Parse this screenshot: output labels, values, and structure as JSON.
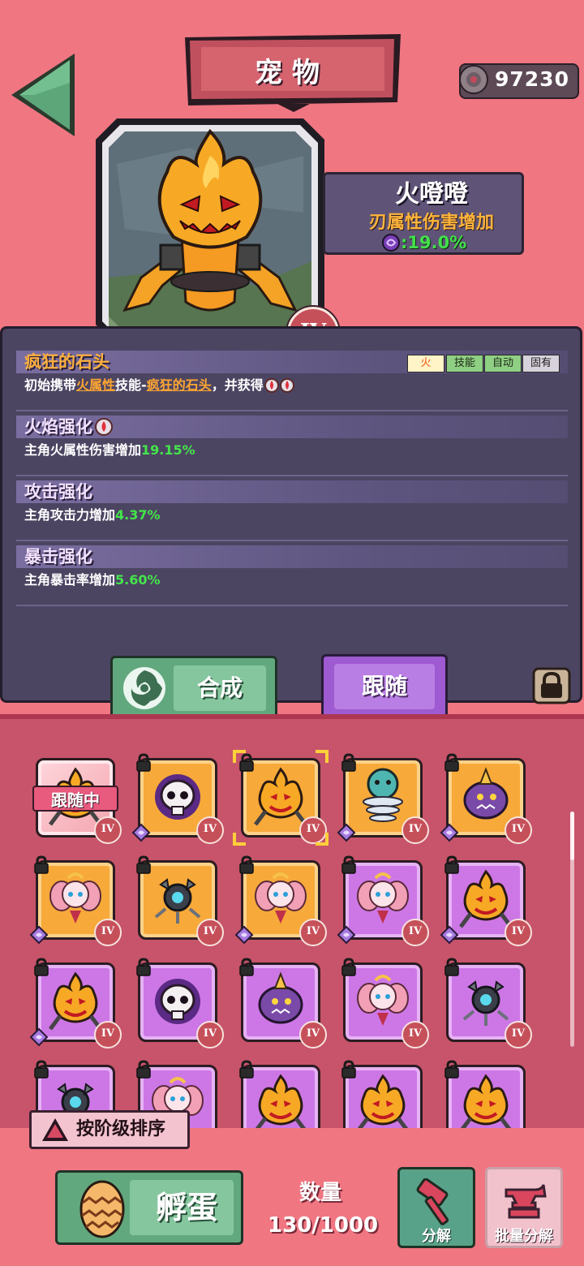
{
  "header": {
    "title": "宠物",
    "coins": "97230"
  },
  "pet": {
    "name": "火噔噔",
    "attribute": "刃属性伤害增加",
    "bonus": ":19.0%",
    "grade": "IV"
  },
  "skills": [
    {
      "title": "疯狂的石头",
      "tags": [
        "火",
        "技能",
        "自动",
        "固有"
      ],
      "desc_prefix": "初始携带",
      "desc_attr": "火属性",
      "desc_mid": "技能-",
      "desc_skill": "疯狂的石头",
      "desc_suffix": "，并获得"
    },
    {
      "title": "火焰强化",
      "desc": "主角火属性伤害增加",
      "value": "19.15%"
    },
    {
      "title": "攻击强化",
      "desc": "主角攻击力增加",
      "value": "4.37%"
    },
    {
      "title": "暴击强化",
      "desc": "主角暴击率增加",
      "value": "5.60%"
    }
  ],
  "buttons": {
    "synth": "合成",
    "follow": "跟随",
    "sort": "按阶级排序",
    "hatch": "孵蛋",
    "decompose": "分解",
    "batch_decompose": "批量分解"
  },
  "grid": {
    "following_label": "跟随中",
    "cells": [
      {
        "bg": "pink",
        "pet": "pumpkin",
        "grade": "IV",
        "lock": false,
        "gem": false,
        "following": true
      },
      {
        "bg": "orange",
        "pet": "skull",
        "grade": "IV",
        "lock": true,
        "gem": true
      },
      {
        "bg": "orange",
        "pet": "pumpkin",
        "grade": "IV",
        "lock": true,
        "gem": false,
        "selected": true
      },
      {
        "bg": "orange",
        "pet": "spring",
        "grade": "IV",
        "lock": true,
        "gem": true
      },
      {
        "bg": "orange",
        "pet": "ghost",
        "grade": "IV",
        "lock": true,
        "gem": true
      },
      {
        "bg": "orange",
        "pet": "fairy",
        "grade": "IV",
        "lock": true,
        "gem": true
      },
      {
        "bg": "orange",
        "pet": "drone",
        "grade": "IV",
        "lock": true,
        "gem": false
      },
      {
        "bg": "orange",
        "pet": "fairy",
        "grade": "IV",
        "lock": true,
        "gem": true
      },
      {
        "bg": "purple",
        "pet": "fairy",
        "grade": "IV",
        "lock": true,
        "gem": true
      },
      {
        "bg": "purple",
        "pet": "pumpkin",
        "grade": "IV",
        "lock": true,
        "gem": true
      },
      {
        "bg": "purple",
        "pet": "pumpkin",
        "grade": "IV",
        "lock": true,
        "gem": true
      },
      {
        "bg": "purple",
        "pet": "skull",
        "grade": "IV",
        "lock": true,
        "gem": false
      },
      {
        "bg": "purple",
        "pet": "ghost",
        "grade": "IV",
        "lock": true,
        "gem": false
      },
      {
        "bg": "purple",
        "pet": "fairy",
        "grade": "IV",
        "lock": true,
        "gem": false
      },
      {
        "bg": "purple",
        "pet": "drone",
        "grade": "IV",
        "lock": true,
        "gem": false
      },
      {
        "bg": "purple",
        "pet": "drone",
        "grade": "",
        "lock": true,
        "gem": false
      },
      {
        "bg": "purple",
        "pet": "fairy",
        "grade": "",
        "lock": true,
        "gem": false
      },
      {
        "bg": "purple",
        "pet": "pumpkin",
        "grade": "",
        "lock": true,
        "gem": false
      },
      {
        "bg": "purple",
        "pet": "pumpkin",
        "grade": "",
        "lock": true,
        "gem": false
      },
      {
        "bg": "purple",
        "pet": "pumpkin",
        "grade": "",
        "lock": true,
        "gem": false
      }
    ]
  },
  "inventory": {
    "label": "数量",
    "count": "130/1000"
  },
  "colors": {
    "background": "#f07682",
    "panel": "#4c4562",
    "green_value": "#43e64a",
    "orange_text": "#ffa632"
  }
}
